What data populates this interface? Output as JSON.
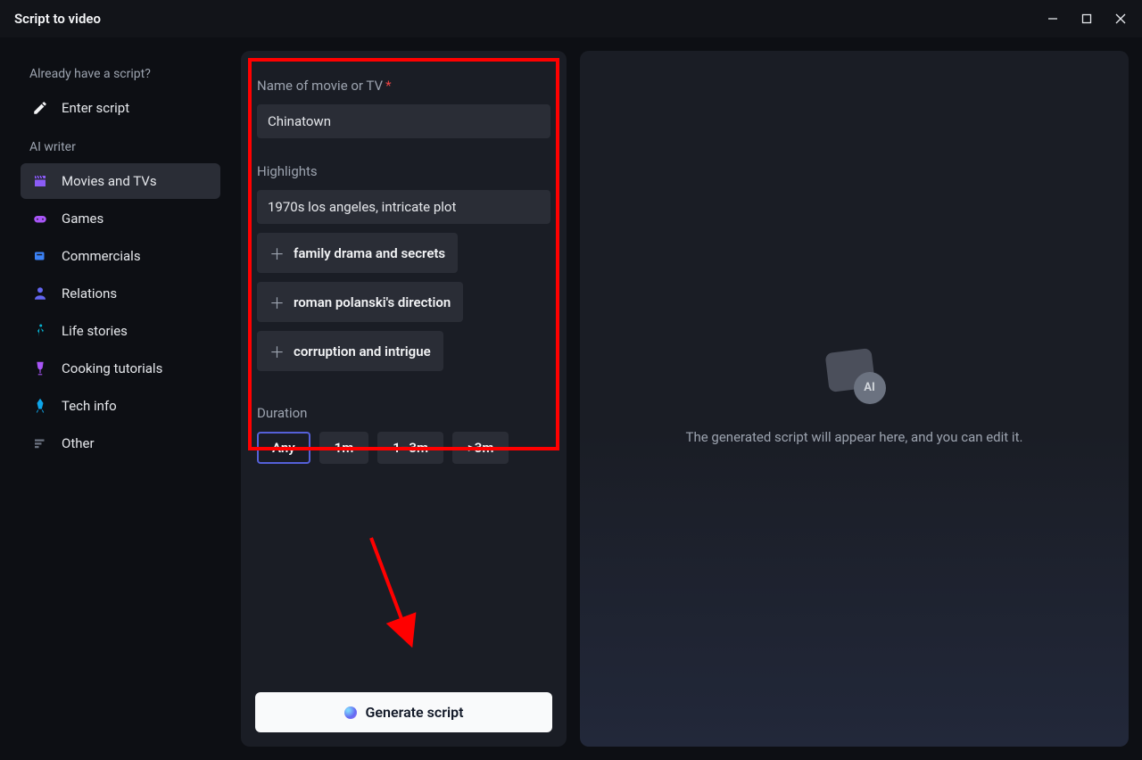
{
  "window": {
    "title": "Script to video"
  },
  "sidebar": {
    "heading_script": "Already have a script?",
    "enter_script": "Enter script",
    "heading_ai": "AI writer",
    "items": [
      {
        "label": "Movies and TVs"
      },
      {
        "label": "Games"
      },
      {
        "label": "Commercials"
      },
      {
        "label": "Relations"
      },
      {
        "label": "Life stories"
      },
      {
        "label": "Cooking tutorials"
      },
      {
        "label": "Tech info"
      },
      {
        "label": "Other"
      }
    ]
  },
  "form": {
    "name_label": "Name of movie or TV",
    "name_value": "Chinatown",
    "highlights_label": "Highlights",
    "highlights_input": "1970s los angeles, intricate plot",
    "tags": [
      "family drama and secrets",
      "roman polanski's direction",
      "corruption and intrigue"
    ],
    "duration_label": "Duration",
    "durations": [
      "Any",
      "1m",
      "1–3m",
      ">3m"
    ]
  },
  "generate": {
    "label": "Generate script"
  },
  "preview": {
    "badge": "AI",
    "text": "The generated script will appear here, and you can edit it."
  }
}
